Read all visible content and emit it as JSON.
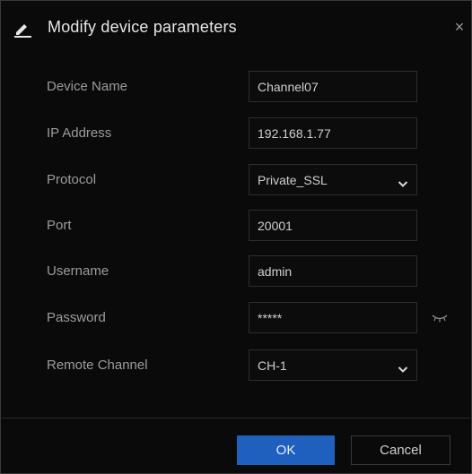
{
  "dialog": {
    "title": "Modify device parameters",
    "title_icon": "edit-pencil-icon",
    "close_icon": "close-icon",
    "close_glyph": "×"
  },
  "form": {
    "device_name": {
      "label": "Device Name",
      "value": "Channel07"
    },
    "ip_address": {
      "label": "IP Address",
      "value": "192.168.1.77"
    },
    "protocol": {
      "label": "Protocol",
      "value": "Private_SSL",
      "icon": "chevron-down-icon"
    },
    "port": {
      "label": "Port",
      "value": "20001"
    },
    "username": {
      "label": "Username",
      "value": "admin"
    },
    "password": {
      "label": "Password",
      "value": "*****",
      "toggle_icon": "eye-closed-icon"
    },
    "remote_channel": {
      "label": "Remote Channel",
      "value": "CH-1",
      "icon": "chevron-down-icon"
    }
  },
  "footer": {
    "ok_label": "OK",
    "cancel_label": "Cancel"
  },
  "colors": {
    "primary_button": "#1f5fbe",
    "background": "#0a0a0a"
  }
}
